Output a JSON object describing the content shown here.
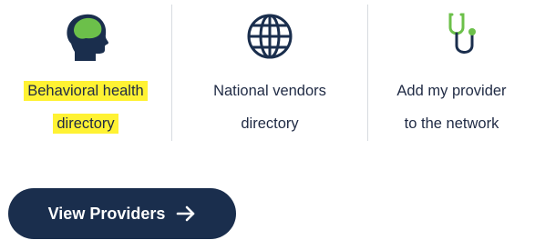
{
  "tiles": [
    {
      "icon": "head-silhouette-icon",
      "label_line1": "Behavioral health",
      "label_line2": "directory",
      "highlighted": true
    },
    {
      "icon": "globe-icon",
      "label_line1": "National vendors",
      "label_line2": "directory",
      "highlighted": false
    },
    {
      "icon": "stethoscope-icon",
      "label_line1": "Add my provider",
      "label_line2": "to the network",
      "highlighted": false
    }
  ],
  "cta": {
    "label": "View Providers",
    "icon": "arrow-right-icon"
  },
  "colors": {
    "navy": "#1a2e4d",
    "green": "#6cc04a",
    "highlight": "#fff233",
    "divider": "#d7dbe0"
  }
}
